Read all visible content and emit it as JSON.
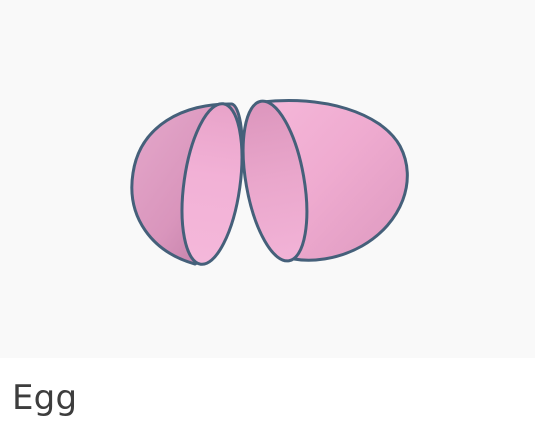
{
  "card": {
    "title": "Egg",
    "model_name": "egg-3d-model"
  },
  "colors": {
    "shell_light": "#f2b2d6",
    "shell_mid": "#e39ac3",
    "shell_dark": "#c87da7",
    "inner": "#f0b0d3",
    "outline": "#45607a",
    "background": "#f9f9f9",
    "title_text": "#3d3d3d"
  }
}
